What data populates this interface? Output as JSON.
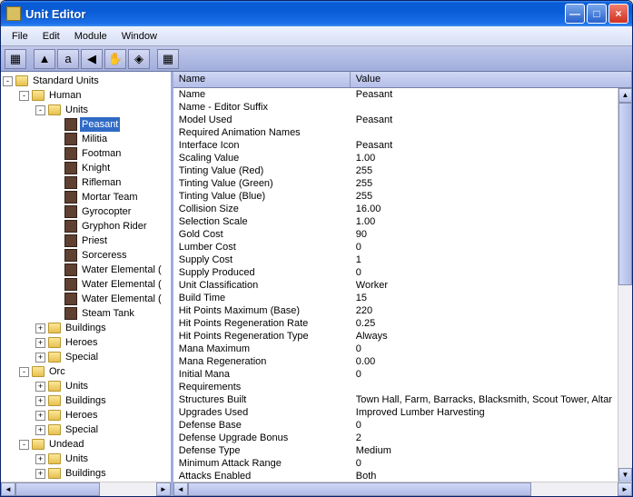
{
  "window": {
    "title": "Unit Editor",
    "buttons": {
      "min": "—",
      "max": "□",
      "close": "×"
    }
  },
  "menu": [
    "File",
    "Edit",
    "Module",
    "Window"
  ],
  "toolbar_icons": [
    "▦",
    "▲",
    "a",
    "◀",
    "✋",
    "◈",
    "▦"
  ],
  "tree": [
    {
      "depth": 0,
      "toggle": "-",
      "type": "folder",
      "label": "Standard Units"
    },
    {
      "depth": 1,
      "toggle": "-",
      "type": "folder",
      "label": "Human"
    },
    {
      "depth": 2,
      "toggle": "-",
      "type": "folder",
      "label": "Units"
    },
    {
      "depth": 3,
      "toggle": "",
      "type": "unit",
      "label": "Peasant",
      "selected": true
    },
    {
      "depth": 3,
      "toggle": "",
      "type": "unit",
      "label": "Militia"
    },
    {
      "depth": 3,
      "toggle": "",
      "type": "unit",
      "label": "Footman"
    },
    {
      "depth": 3,
      "toggle": "",
      "type": "unit",
      "label": "Knight"
    },
    {
      "depth": 3,
      "toggle": "",
      "type": "unit",
      "label": "Rifleman"
    },
    {
      "depth": 3,
      "toggle": "",
      "type": "unit",
      "label": "Mortar Team"
    },
    {
      "depth": 3,
      "toggle": "",
      "type": "unit",
      "label": "Gyrocopter"
    },
    {
      "depth": 3,
      "toggle": "",
      "type": "unit",
      "label": "Gryphon Rider"
    },
    {
      "depth": 3,
      "toggle": "",
      "type": "unit",
      "label": "Priest"
    },
    {
      "depth": 3,
      "toggle": "",
      "type": "unit",
      "label": "Sorceress"
    },
    {
      "depth": 3,
      "toggle": "",
      "type": "unit",
      "label": "Water Elemental ("
    },
    {
      "depth": 3,
      "toggle": "",
      "type": "unit",
      "label": "Water Elemental ("
    },
    {
      "depth": 3,
      "toggle": "",
      "type": "unit",
      "label": "Water Elemental ("
    },
    {
      "depth": 3,
      "toggle": "",
      "type": "unit",
      "label": "Steam Tank"
    },
    {
      "depth": 2,
      "toggle": "+",
      "type": "folder",
      "label": "Buildings"
    },
    {
      "depth": 2,
      "toggle": "+",
      "type": "folder",
      "label": "Heroes"
    },
    {
      "depth": 2,
      "toggle": "+",
      "type": "folder",
      "label": "Special"
    },
    {
      "depth": 1,
      "toggle": "-",
      "type": "folder",
      "label": "Orc"
    },
    {
      "depth": 2,
      "toggle": "+",
      "type": "folder",
      "label": "Units"
    },
    {
      "depth": 2,
      "toggle": "+",
      "type": "folder",
      "label": "Buildings"
    },
    {
      "depth": 2,
      "toggle": "+",
      "type": "folder",
      "label": "Heroes"
    },
    {
      "depth": 2,
      "toggle": "+",
      "type": "folder",
      "label": "Special"
    },
    {
      "depth": 1,
      "toggle": "-",
      "type": "folder",
      "label": "Undead"
    },
    {
      "depth": 2,
      "toggle": "+",
      "type": "folder",
      "label": "Units"
    },
    {
      "depth": 2,
      "toggle": "+",
      "type": "folder",
      "label": "Buildings"
    }
  ],
  "grid": {
    "columns": {
      "name": "Name",
      "value": "Value"
    },
    "rows": [
      {
        "name": "Name",
        "value": "Peasant"
      },
      {
        "name": "Name - Editor Suffix",
        "value": ""
      },
      {
        "name": "Model Used",
        "value": "Peasant"
      },
      {
        "name": "Required Animation Names",
        "value": ""
      },
      {
        "name": "Interface Icon",
        "value": "Peasant"
      },
      {
        "name": "Scaling Value",
        "value": "1.00"
      },
      {
        "name": "Tinting Value (Red)",
        "value": "255"
      },
      {
        "name": "Tinting Value (Green)",
        "value": "255"
      },
      {
        "name": "Tinting Value (Blue)",
        "value": "255"
      },
      {
        "name": "Collision Size",
        "value": "16.00"
      },
      {
        "name": "Selection Scale",
        "value": "1.00"
      },
      {
        "name": "Gold Cost",
        "value": "90"
      },
      {
        "name": "Lumber Cost",
        "value": "0"
      },
      {
        "name": "Supply Cost",
        "value": "1"
      },
      {
        "name": "Supply Produced",
        "value": "0"
      },
      {
        "name": "Unit Classification",
        "value": "Worker"
      },
      {
        "name": "Build Time",
        "value": "15"
      },
      {
        "name": "Hit Points Maximum (Base)",
        "value": "220"
      },
      {
        "name": "Hit Points Regeneration Rate",
        "value": "0.25"
      },
      {
        "name": "Hit Points Regeneration Type",
        "value": "Always"
      },
      {
        "name": "Mana Maximum",
        "value": "0"
      },
      {
        "name": "Mana Regeneration",
        "value": "0.00"
      },
      {
        "name": "Initial Mana",
        "value": "0"
      },
      {
        "name": "Requirements",
        "value": ""
      },
      {
        "name": "Structures Built",
        "value": "Town Hall, Farm, Barracks, Blacksmith, Scout Tower, Altar"
      },
      {
        "name": "Upgrades Used",
        "value": "Improved Lumber Harvesting"
      },
      {
        "name": "Defense Base",
        "value": "0"
      },
      {
        "name": "Defense Upgrade Bonus",
        "value": "2"
      },
      {
        "name": "Defense Type",
        "value": "Medium"
      },
      {
        "name": "Minimum Attack Range",
        "value": "0"
      },
      {
        "name": "Attacks Enabled",
        "value": "Both"
      }
    ]
  }
}
